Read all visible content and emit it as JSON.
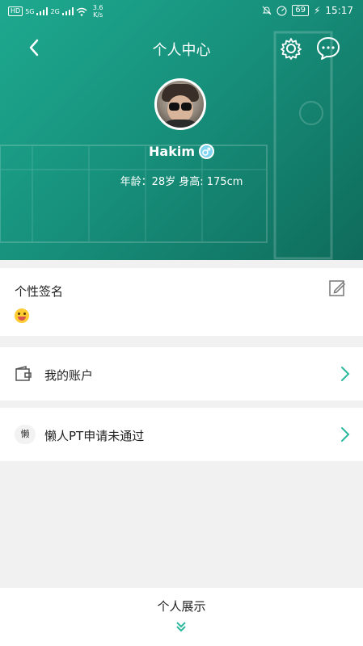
{
  "status_bar": {
    "hd_badge": "HD",
    "network_5g": "5G",
    "network_2g": "2G",
    "speed_value": "3.6",
    "speed_unit": "K/s",
    "battery": "69",
    "time": "15:17"
  },
  "nav": {
    "title": "个人中心"
  },
  "profile": {
    "username": "Hakim",
    "gender_symbol": "♂",
    "info": "年龄：28岁   身高: 175cm"
  },
  "signature": {
    "title": "个性签名",
    "emoji": "😜"
  },
  "menu": [
    {
      "label": "我的账户",
      "icon": "wallet-icon"
    },
    {
      "label": "懒人PT申请未通过",
      "icon": "lazy-badge-icon",
      "badge_text": "懒"
    }
  ],
  "bottom": {
    "label": "个人展示"
  },
  "colors": {
    "accent": "#1aa08a",
    "arrow": "#2bb89c"
  }
}
